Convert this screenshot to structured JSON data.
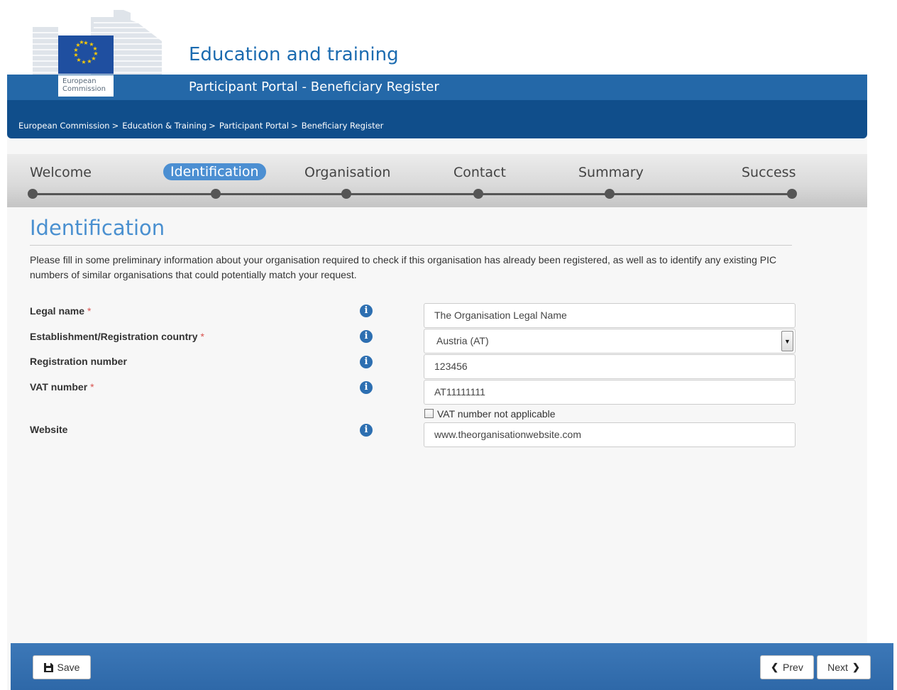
{
  "header": {
    "app_title": "Education and training",
    "app_subtitle": "Participant Portal - Beneficiary Register",
    "logo_text_line1": "European",
    "logo_text_line2": "Commission"
  },
  "breadcrumb": [
    {
      "label": "European Commission"
    },
    {
      "label": "Education & Training"
    },
    {
      "label": "Participant Portal"
    },
    {
      "label": "Beneficiary Register"
    }
  ],
  "steps": [
    {
      "label": "Welcome",
      "active": false
    },
    {
      "label": "Identification",
      "active": true
    },
    {
      "label": "Organisation",
      "active": false
    },
    {
      "label": "Contact",
      "active": false
    },
    {
      "label": "Summary",
      "active": false
    },
    {
      "label": "Success",
      "active": false
    }
  ],
  "main": {
    "section_title": "Identification",
    "intro": "Please fill in some preliminary information about your organisation required to check if this organisation has already been registered, as well as to identify any existing PIC numbers of similar organisations that could potentially match your request.",
    "required_marker": "*",
    "info_glyph": "i",
    "fields": {
      "legal_name": {
        "label": "Legal name",
        "required": true,
        "value": "The Organisation Legal Name"
      },
      "country": {
        "label": "Establishment/Registration country",
        "required": true,
        "value": "Austria (AT)"
      },
      "registration_number": {
        "label": "Registration number",
        "required": false,
        "value": "123456"
      },
      "vat_number": {
        "label": "VAT number",
        "required": true,
        "value": "AT11111111"
      },
      "vat_not_applicable": {
        "label": "VAT number not applicable",
        "checked": false
      },
      "website": {
        "label": "Website",
        "required": false,
        "value": "www.theorganisationwebsite.com"
      }
    }
  },
  "footer": {
    "save_label": "Save",
    "prev_label": "Prev",
    "next_label": "Next"
  },
  "colors": {
    "brand_blue": "#2468a8",
    "dark_blue": "#104e8b",
    "accent_blue": "#4c8fd2",
    "required_red": "#d9534f"
  },
  "icons": [
    "eu-flag-icon",
    "info-icon",
    "save-icon",
    "chevron-left-icon",
    "chevron-right-icon",
    "dropdown-arrow-icon"
  ]
}
